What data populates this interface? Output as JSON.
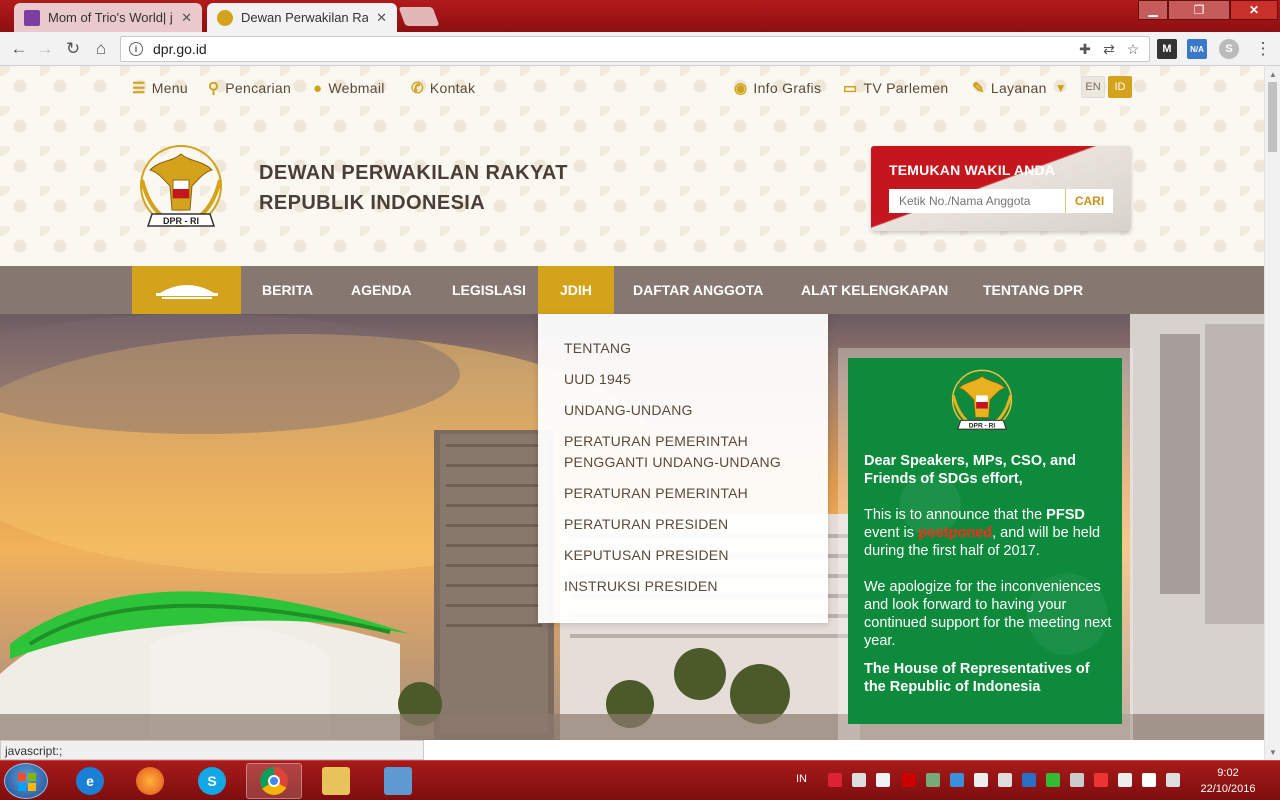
{
  "browser": {
    "tabs": [
      {
        "title": "Mom of Trio's World| jen",
        "active": false
      },
      {
        "title": "Dewan Perwakilan Rakya",
        "active": true
      }
    ],
    "url": "dpr.go.id",
    "status_text": "javascript:;"
  },
  "topnav": {
    "left": [
      {
        "label": "Menu",
        "icon": "menu-icon"
      },
      {
        "label": "Pencarian",
        "icon": "search-icon"
      },
      {
        "label": "Webmail",
        "icon": "user-icon"
      },
      {
        "label": "Kontak",
        "icon": "phone-icon"
      }
    ],
    "right": [
      {
        "label": "Info Grafis",
        "icon": "lightbulb-icon"
      },
      {
        "label": "TV Parlemen",
        "icon": "tv-icon"
      },
      {
        "label": "Layanan",
        "icon": "edit-icon"
      }
    ],
    "lang_en": "EN",
    "lang_id": "ID"
  },
  "site": {
    "title_line1": "DEWAN PERWAKILAN RAKYAT",
    "title_line2": "REPUBLIK INDONESIA",
    "emblem_text": "DPR - RI"
  },
  "finder": {
    "label": "TEMUKAN WAKIL ANDA",
    "placeholder": "Ketik No./Nama Anggota",
    "button": "CARI"
  },
  "mainnav": {
    "items": [
      "BERITA",
      "AGENDA",
      "LEGISLASI",
      "JDIH",
      "DAFTAR ANGGOTA",
      "ALAT KELENGKAPAN",
      "TENTANG DPR"
    ],
    "active": "JDIH"
  },
  "dropdown": {
    "items": [
      "TENTANG",
      "UUD 1945",
      "UNDANG-UNDANG",
      "PERATURAN PEMERINTAH PENGGANTI UNDANG-UNDANG",
      "PERATURAN PEMERINTAH",
      "PERATURAN PRESIDEN",
      "KEPUTUSAN PRESIDEN",
      "INSTRUKSI PRESIDEN"
    ]
  },
  "notice": {
    "greeting": "Dear Speakers, MPs, CSO, and Friends of SDGs effort,",
    "p1_a": "This is to announce that the ",
    "p1_pfsd": "PFSD",
    "p1_b": " event is ",
    "p1_postponed": "postponed",
    "p1_c": ", and will be held during the first half of 2017.",
    "p2": "We apologize for the inconveniences and look forward to having your continued support for the meeting next year.",
    "signature": "The House of Representatives of the Republic of Indonesia"
  },
  "taskbar": {
    "lang": "IN",
    "time": "9:02",
    "date": "22/10/2016"
  },
  "colors": {
    "gold": "#d4a21b",
    "nav_bg": "#877771",
    "notice_green": "#0e8a3d",
    "finder_red": "#c4161c",
    "chrome_red": "#a81a1a"
  }
}
